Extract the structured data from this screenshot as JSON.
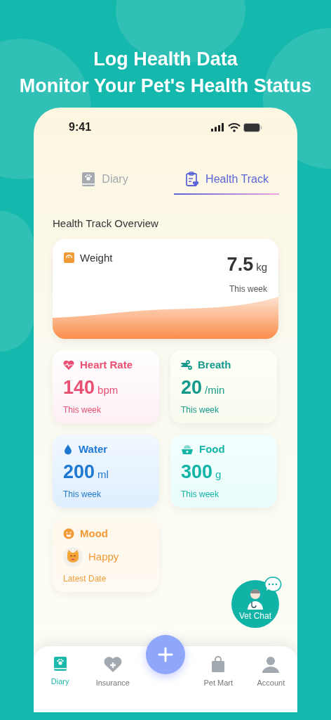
{
  "headline": [
    "Log Health Data",
    "Monitor Your Pet's Health Status"
  ],
  "status_bar": {
    "time": "9:41"
  },
  "tabs": [
    {
      "label": "Diary",
      "selected": false
    },
    {
      "label": "Health Track",
      "selected": true
    }
  ],
  "section_title": "Health Track Overview",
  "weight": {
    "label": "Weight",
    "value": "7.5",
    "unit": "kg",
    "caption": "This week"
  },
  "metrics": [
    {
      "kind": "reading",
      "label": "Heart Rate",
      "value": "140",
      "unit": "bpm",
      "caption": "This week",
      "color": "#e94f72"
    },
    {
      "kind": "reading",
      "label": "Breath",
      "value": "20",
      "unit": "/min",
      "caption": "This week",
      "color": "#14998c"
    },
    {
      "kind": "reading",
      "label": "Water",
      "value": "200",
      "unit": "ml",
      "caption": "This week",
      "color": "#1e78d2"
    },
    {
      "kind": "reading",
      "label": "Food",
      "value": "300",
      "unit": "g",
      "caption": "This week",
      "color": "#13b5a7"
    },
    {
      "kind": "mood",
      "label": "Mood",
      "value": "Happy",
      "caption": "Latest Date",
      "color": "#f19a38"
    }
  ],
  "vet_chat": {
    "label": "Vet Chat"
  },
  "nav": [
    {
      "kind": "tab",
      "label": "Diary",
      "selected": true
    },
    {
      "kind": "tab",
      "label": "Insurance",
      "selected": false
    },
    {
      "kind": "add"
    },
    {
      "kind": "tab",
      "label": "Pet Mart",
      "selected": false
    },
    {
      "kind": "tab",
      "label": "Account",
      "selected": false
    }
  ]
}
